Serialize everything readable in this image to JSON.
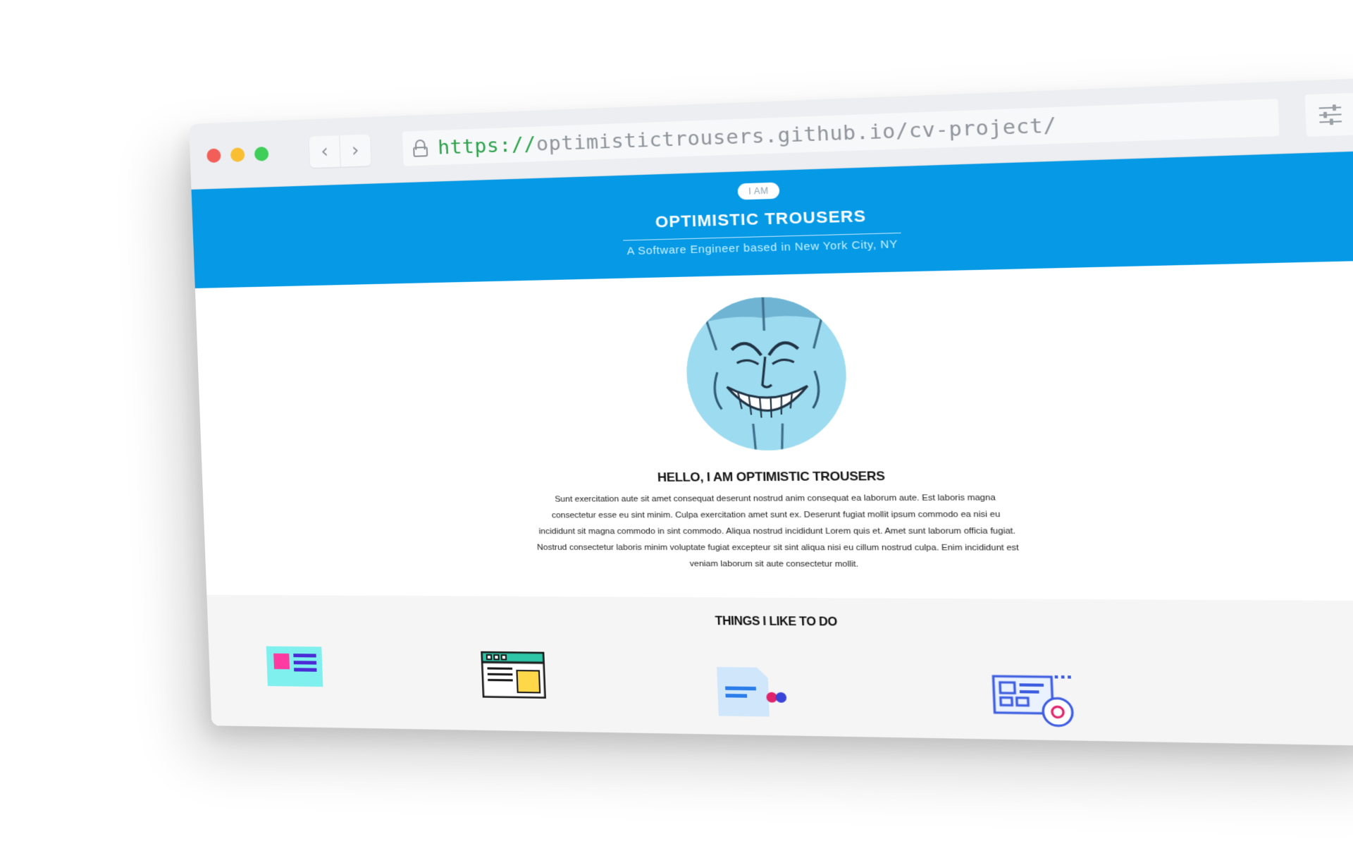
{
  "browser": {
    "url_protocol": "https://",
    "url_rest": "optimistictrousers.github.io/cv-project/",
    "nav": {
      "back": "‹",
      "forward": "›"
    }
  },
  "hero": {
    "pill": "I AM",
    "name": "OPTIMISTIC TROUSERS",
    "subtitle": "A Software Engineer based in New York City, NY",
    "colors": {
      "background": "#0599e6",
      "subtitle": "#c9f2ff"
    }
  },
  "about": {
    "heading": "HELLO, I AM OPTIMISTIC TROUSERS",
    "bio": "Sunt exercitation aute sit amet consequat deserunt nostrud anim consequat ea laborum aute. Est laboris magna consectetur esse eu sint minim. Culpa exercitation amet sunt ex. Deserunt fugiat mollit ipsum commodo ea nisi eu incididunt sit magna commodo in sint commodo. Aliqua nostrud incididunt Lorem quis et. Amet sunt laborum officia fugiat. Nostrud consectetur laboris minim voluptate fugiat excepteur sit sint aliqua nisi eu cillum nostrud culpa. Enim incididunt est veniam laborum sit aute consectetur mollit."
  },
  "things": {
    "heading": "THINGS I LIKE TO DO",
    "icons": [
      "layout-cards-icon",
      "browser-window-icon",
      "document-edit-icon",
      "web-shortcut-icon"
    ]
  }
}
